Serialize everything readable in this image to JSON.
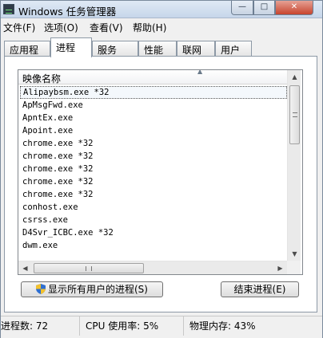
{
  "window": {
    "title": "Windows 任务管理器",
    "controls": {
      "minimize": "—",
      "maximize": "□",
      "close": "✕"
    }
  },
  "menubar": {
    "items": [
      {
        "label": "文件(F)"
      },
      {
        "label": "选项(O)"
      },
      {
        "label": "查看(V)"
      },
      {
        "label": "帮助(H)"
      }
    ]
  },
  "tabs": [
    {
      "label": "应用程序"
    },
    {
      "label": "进程",
      "active": true
    },
    {
      "label": "服务"
    },
    {
      "label": "性能"
    },
    {
      "label": "联网"
    },
    {
      "label": "用户"
    }
  ],
  "process_list": {
    "column_header": "映像名称",
    "rows": [
      {
        "name": "Alipaybsm.exe *32",
        "selected": true
      },
      {
        "name": "ApMsgFwd.exe"
      },
      {
        "name": "ApntEx.exe"
      },
      {
        "name": "Apoint.exe"
      },
      {
        "name": "chrome.exe *32"
      },
      {
        "name": "chrome.exe *32"
      },
      {
        "name": "chrome.exe *32"
      },
      {
        "name": "chrome.exe *32"
      },
      {
        "name": "chrome.exe *32"
      },
      {
        "name": "conhost.exe"
      },
      {
        "name": "csrss.exe"
      },
      {
        "name": "D4Svr_ICBC.exe *32"
      },
      {
        "name": "dwm.exe"
      }
    ],
    "scroll_arrow_up": "▲",
    "scroll_arrow_down": "▼",
    "scroll_arrow_left": "◀",
    "scroll_arrow_right": "▶"
  },
  "buttons": {
    "show_all_processes": "显示所有用户的进程(S)",
    "end_process": "结束进程(E)"
  },
  "statusbar": {
    "process_count": "进程数: 72",
    "cpu_usage": "CPU 使用率: 5%",
    "memory": "物理内存: 43%"
  },
  "colors": {
    "title_gradient_top": "#dfe9f5",
    "close_button": "#c7442e",
    "shield_blue": "#2f6fd0",
    "shield_yellow": "#f2c12e"
  }
}
